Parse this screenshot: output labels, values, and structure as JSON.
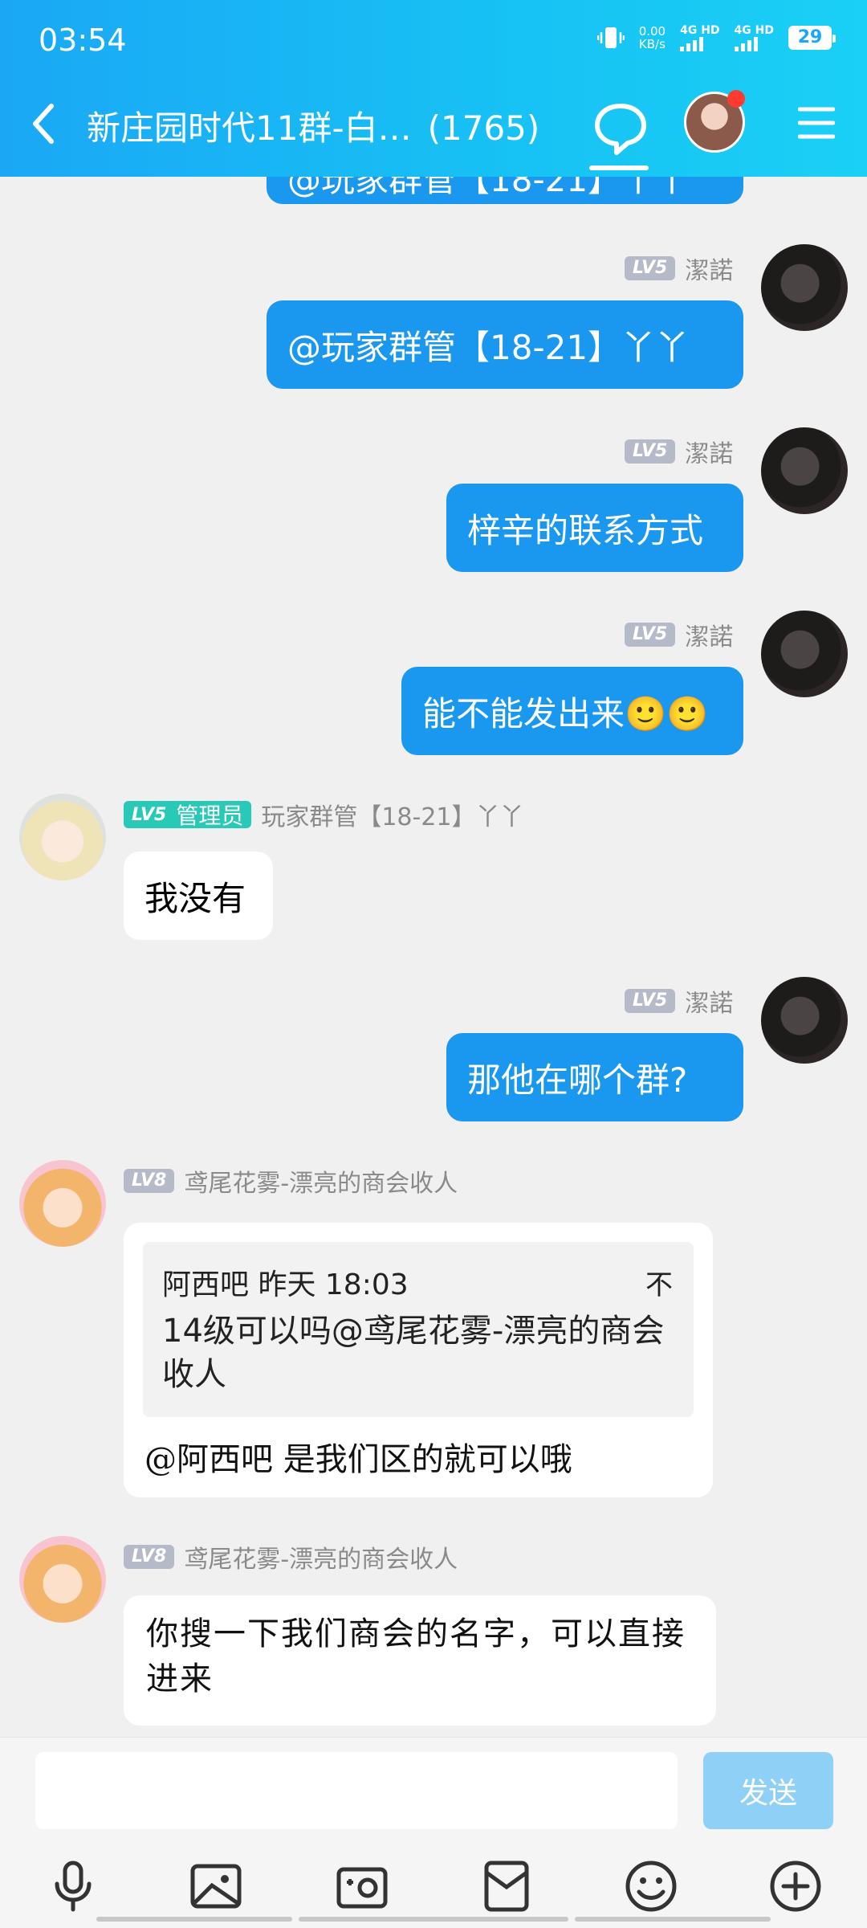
{
  "status_bar": {
    "time": "03:54",
    "net_speed_value": "0.00",
    "net_speed_unit": "KB/s",
    "sim1": "4G HD",
    "sim2": "4G HD",
    "battery": "29"
  },
  "header": {
    "title": "新庄园时代11群-白…",
    "member_count": "(1765)",
    "icons": [
      "back-icon",
      "chat-bubble-icon",
      "group-avatar",
      "menu-icon"
    ]
  },
  "messages": [
    {
      "side": "right",
      "text": "@玩家群管【18-21】丫丫",
      "partial": true
    },
    {
      "side": "right",
      "level": "LV5",
      "sender": "潔諾",
      "text": "@玩家群管【18-21】丫丫"
    },
    {
      "side": "right",
      "level": "LV5",
      "sender": "潔諾",
      "text": "梓辛的联系方式"
    },
    {
      "side": "right",
      "level": "LV5",
      "sender": "潔諾",
      "text": "能不能发出来🙂🙂"
    },
    {
      "side": "left",
      "level": "LV5",
      "role": "管理员",
      "sender": "玩家群管【18-21】丫丫",
      "text": "我没有"
    },
    {
      "side": "right",
      "level": "LV5",
      "sender": "潔諾",
      "text": "那他在哪个群?"
    },
    {
      "side": "left",
      "level": "LV8",
      "sender": "鸢尾花雾-漂亮的商会收人",
      "quote": {
        "header": "阿西吧 昨天 18:03",
        "pin": "不",
        "text": "14级可以吗@鸢尾花雾-漂亮的商会收人"
      },
      "text": "@阿西吧 是我们区的就可以哦"
    },
    {
      "side": "left",
      "level": "LV8",
      "sender": "鸢尾花雾-漂亮的商会收人",
      "text": "你搜一下我们商会的名字，可以直接进来"
    }
  ],
  "input_bar": {
    "placeholder": "",
    "send_label": "发送",
    "tools": [
      "microphone-icon",
      "image-icon",
      "camera-icon",
      "red-packet-icon",
      "emoji-icon",
      "plus-icon"
    ]
  },
  "colors": {
    "header": "#1aa8f5",
    "bubble_blue": "#1a97ee",
    "send_disabled": "#8fd0f7",
    "admin_badge": "#29c9b7"
  }
}
